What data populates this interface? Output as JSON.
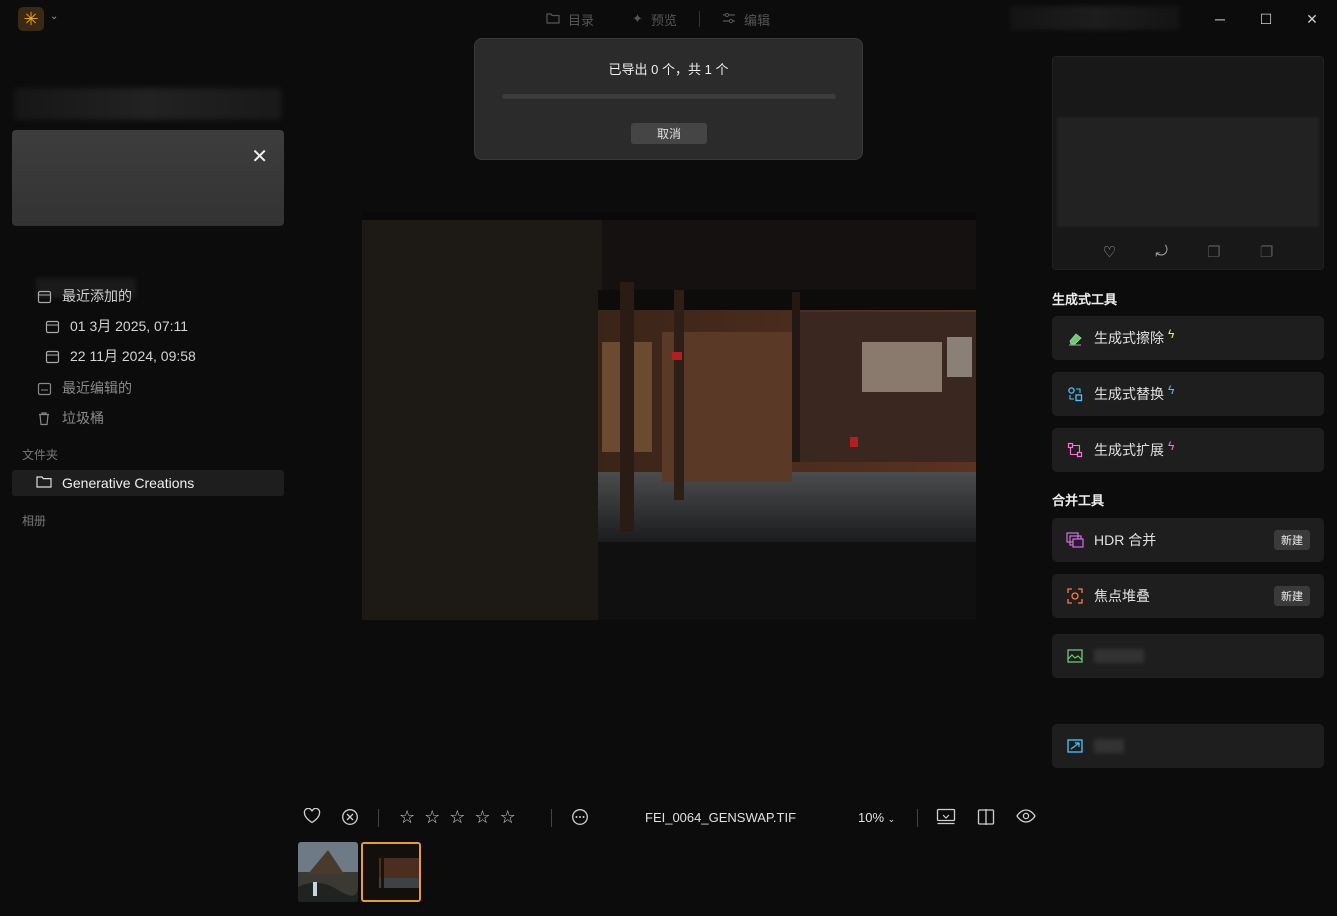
{
  "topbar": {
    "logo_glyph": "✳",
    "tabs": [
      {
        "label": "目录",
        "icon": "folder-icon"
      },
      {
        "label": "预览",
        "icon": "sparkle-icon"
      },
      {
        "label": "编辑",
        "icon": "sliders-icon"
      }
    ],
    "window_controls": {
      "minimize": "─",
      "maximize": "☐",
      "close": "✕"
    }
  },
  "sidebar": {
    "recent_added": "最近添加的",
    "dates": [
      "01 3月 2025, 07:11",
      "22 11月 2024, 09:58"
    ],
    "recent_edited": "最近编辑的",
    "trash": "垃圾桶",
    "folders_label": "文件夹",
    "folder_name": "Generative Creations",
    "albums_label": "相册"
  },
  "export_dialog": {
    "title": "已导出 0 个，共 1 个",
    "progress": 0,
    "cancel_label": "取消"
  },
  "bottombar": {
    "filename": "FEI_0064_GENSWAP.TIF",
    "zoom": "10%",
    "rating": 0,
    "max_rating": 5
  },
  "right_panel": {
    "generative_heading": "生成式工具",
    "generative_tools": [
      {
        "label": "生成式擦除",
        "icon": "eraser-icon",
        "color": "#6cc970"
      },
      {
        "label": "生成式替换",
        "icon": "replace-icon",
        "color": "#4cc3ff"
      },
      {
        "label": "生成式扩展",
        "icon": "expand-icon",
        "color": "#ff6fd8"
      }
    ],
    "merge_heading": "合并工具",
    "merge_tools": [
      {
        "label": "HDR 合并",
        "badge": "新建",
        "icon": "hdr-icon",
        "color": "#d36fe0"
      },
      {
        "label": "焦点堆叠",
        "badge": "新建",
        "icon": "focus-icon",
        "color": "#ff7a4a"
      }
    ]
  },
  "colors": {
    "accent": "#e89a3c",
    "bolt_generative": "#c9ff5a"
  }
}
